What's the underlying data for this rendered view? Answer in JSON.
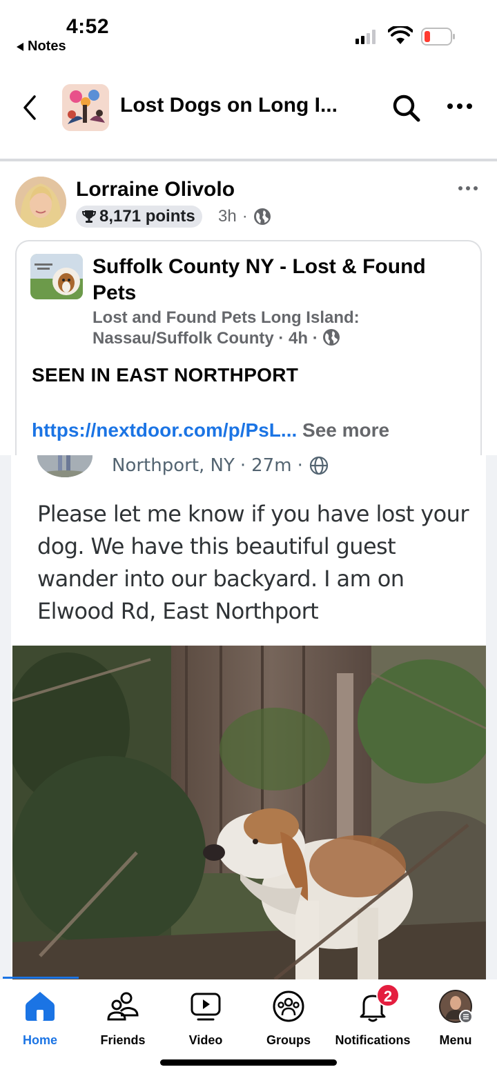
{
  "status_bar": {
    "time": "4:52",
    "back_app": "Notes"
  },
  "header": {
    "group_title": "Lost Dogs on Long I...",
    "icons": [
      "chevron-left-icon",
      "search-icon",
      "more-icon"
    ]
  },
  "post": {
    "author": "Lorraine Olivolo",
    "points": "8,171 points",
    "time": "3h",
    "separator": "·",
    "privacy": "globe-icon"
  },
  "shared": {
    "page_name": "Suffolk County NY -  Lost & Found Pets",
    "source": "Lost and Found Pets Long Island: Nassau/Suffolk County",
    "time": "4h",
    "separator": "·",
    "text": "SEEN IN EAST NORTHPORT",
    "link": "https://nextdoor.com/p/PsL...",
    "see_more": "See more"
  },
  "screenshot": {
    "location": "Northport, NY",
    "time": "27m",
    "separator": "·",
    "text": "Please let me know if you have lost your dog. We have this beautiful guest wander into our backyard. I am on Elwood Rd, East Northport"
  },
  "bottom_nav": {
    "items": [
      {
        "label": "Home",
        "icon": "home-icon",
        "active": true
      },
      {
        "label": "Friends",
        "icon": "friends-icon"
      },
      {
        "label": "Video",
        "icon": "video-icon"
      },
      {
        "label": "Groups",
        "icon": "groups-icon"
      },
      {
        "label": "Notifications",
        "icon": "bell-icon",
        "badge": "2"
      },
      {
        "label": "Menu",
        "icon": "profile-avatar"
      }
    ]
  },
  "colors": {
    "accent": "#1b74e4",
    "badge": "#e41e3f",
    "muted": "#65676b"
  }
}
